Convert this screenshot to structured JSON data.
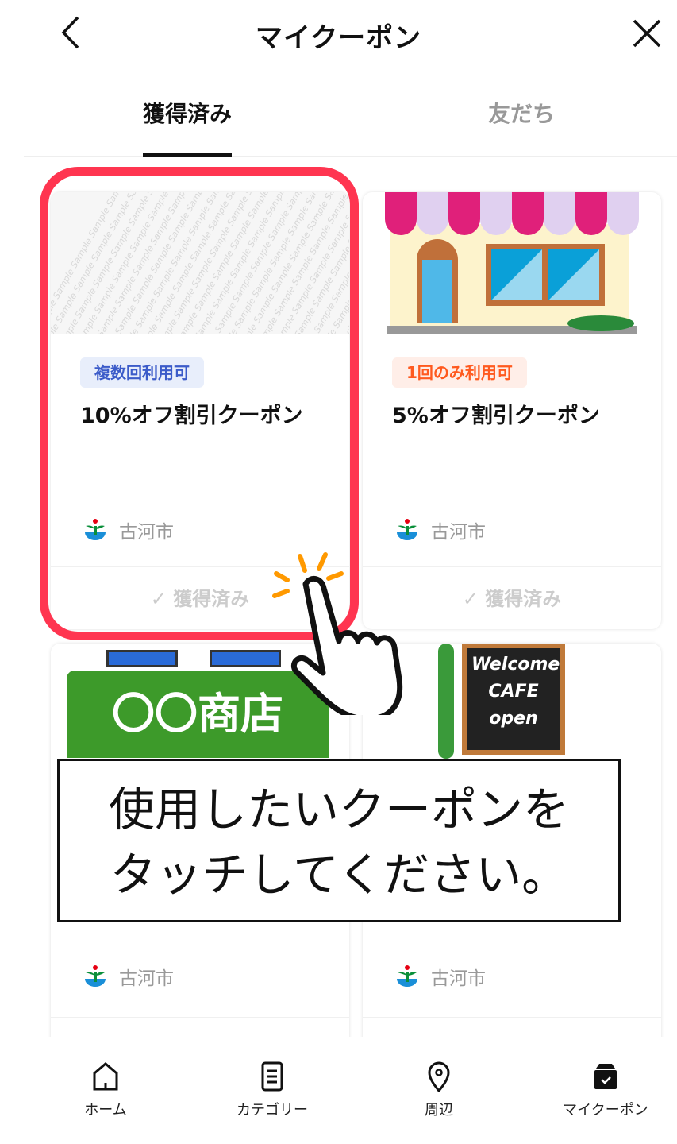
{
  "header": {
    "title": "マイクーポン",
    "back_icon": "chevron-left-icon",
    "close_icon": "close-icon"
  },
  "tabs": [
    {
      "label": "獲得済み",
      "active": true
    },
    {
      "label": "友だち",
      "active": false
    }
  ],
  "cards": [
    {
      "badge": "複数回利用可",
      "badge_color": "#3b5bc9",
      "badge_bg": "#e8eefb",
      "title": "10%オフ割引クーポン",
      "issuer": "古河市",
      "status": "獲得済み",
      "image": "sample-pattern",
      "image_text": "Sample"
    },
    {
      "badge": "1回のみ利用可",
      "badge_color": "#ff5a1f",
      "badge_bg": "#ffeee8",
      "title": "5%オフ割引クーポン",
      "issuer": "古河市",
      "status": "獲得済み",
      "image": "storefront"
    },
    {
      "title": "",
      "issuer": "古河市",
      "image": "shop-sign",
      "image_text": "〇〇商店"
    },
    {
      "title": "",
      "issuer": "古河市",
      "image": "cafe-sign",
      "image_text": "Welcome CAFE open"
    }
  ],
  "nav": [
    {
      "label": "ホーム",
      "icon": "home-icon"
    },
    {
      "label": "カテゴリー",
      "icon": "list-icon"
    },
    {
      "label": "周辺",
      "icon": "location-pin-icon"
    },
    {
      "label": "マイクーポン",
      "icon": "coupon-box-icon",
      "active": true
    }
  ],
  "callout": {
    "line1": "使用したいクーポンを",
    "line2": "タッチしてください。"
  },
  "colors": {
    "highlight": "#ff3550",
    "accent_orange": "#ff9900"
  }
}
